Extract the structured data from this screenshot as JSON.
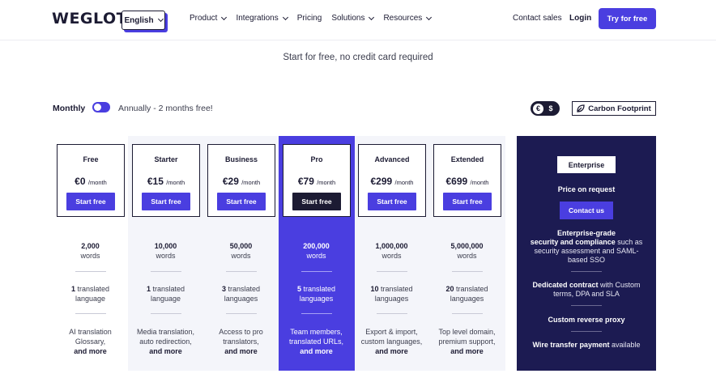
{
  "header": {
    "logo": "WEGLOT",
    "language": "English",
    "nav": [
      "Product",
      "Integrations",
      "Pricing",
      "Solutions",
      "Resources"
    ],
    "contact_sales": "Contact sales",
    "login": "Login",
    "try_free": "Try for free"
  },
  "subtitle": "Start for free, no credit card required",
  "billing": {
    "monthly": "Monthly",
    "annually": "Annually - 2 months free!",
    "currency_eur": "€",
    "currency_usd": "$",
    "carbon": "Carbon Footprint"
  },
  "colors": {
    "accent": "#4a3ee0",
    "dark": "#1c1b33",
    "enterprise_bg": "#1c1b52",
    "light_bg": "#f4f5fa"
  },
  "plans": [
    {
      "name": "Free",
      "price": "€0",
      "per": "/month",
      "cta": "Start free",
      "words": "2,000",
      "words_label": "words",
      "lang_num": "1",
      "lang_label": "translated",
      "lang_label2": "language",
      "extra1": "AI translation",
      "extra2": "Glossary,",
      "extra_more": "and more"
    },
    {
      "name": "Starter",
      "price": "€15",
      "per": "/month",
      "cta": "Start free",
      "words": "10,000",
      "words_label": "words",
      "lang_num": "1",
      "lang_label": "translated",
      "lang_label2": "language",
      "extra1": "Media translation,",
      "extra2": "auto redirection,",
      "extra_more": "and more"
    },
    {
      "name": "Business",
      "price": "€29",
      "per": "/month",
      "cta": "Start free",
      "words": "50,000",
      "words_label": "words",
      "lang_num": "3",
      "lang_label": "translated",
      "lang_label2": "languages",
      "extra1": "Access to pro",
      "extra2": "translators,",
      "extra_more": "and more"
    },
    {
      "name": "Pro",
      "price": "€79",
      "per": "/month",
      "cta": "Start free",
      "words": "200,000",
      "words_label": "words",
      "lang_num": "5",
      "lang_label": "translated",
      "lang_label2": "languages",
      "extra1": "Team members,",
      "extra2": "translated URLs,",
      "extra_more": "and more"
    },
    {
      "name": "Advanced",
      "price": "€299",
      "per": "/month",
      "cta": "Start free",
      "words": "1,000,000",
      "words_label": "words",
      "lang_num": "10",
      "lang_label": "translated",
      "lang_label2": "languages",
      "extra1": "Export & import,",
      "extra2": "custom languages,",
      "extra_more": "and more"
    },
    {
      "name": "Extended",
      "price": "€699",
      "per": "/month",
      "cta": "Start free",
      "words": "5,000,000",
      "words_label": "words",
      "lang_num": "20",
      "lang_label": "translated",
      "lang_label2": "languages",
      "extra1": "Top level domain,",
      "extra2": "premium support,",
      "extra_more": "and more"
    }
  ],
  "enterprise": {
    "name": "Enterprise",
    "price": "Price on request",
    "cta": "Contact us",
    "f1_bold1": "Enterprise-grade",
    "f1_bold2": "security and compliance",
    "f1_rest1": " such as",
    "f1_rest2": "security assessment and SAML-",
    "f1_rest3": "based SSO",
    "f2_bold": "Dedicated contract",
    "f2_rest1": " with Custom",
    "f2_rest2": "terms, DPA and SLA",
    "f3_bold": "Custom reverse proxy",
    "f4_bold": "Wire transfer payment",
    "f4_rest": " available"
  }
}
